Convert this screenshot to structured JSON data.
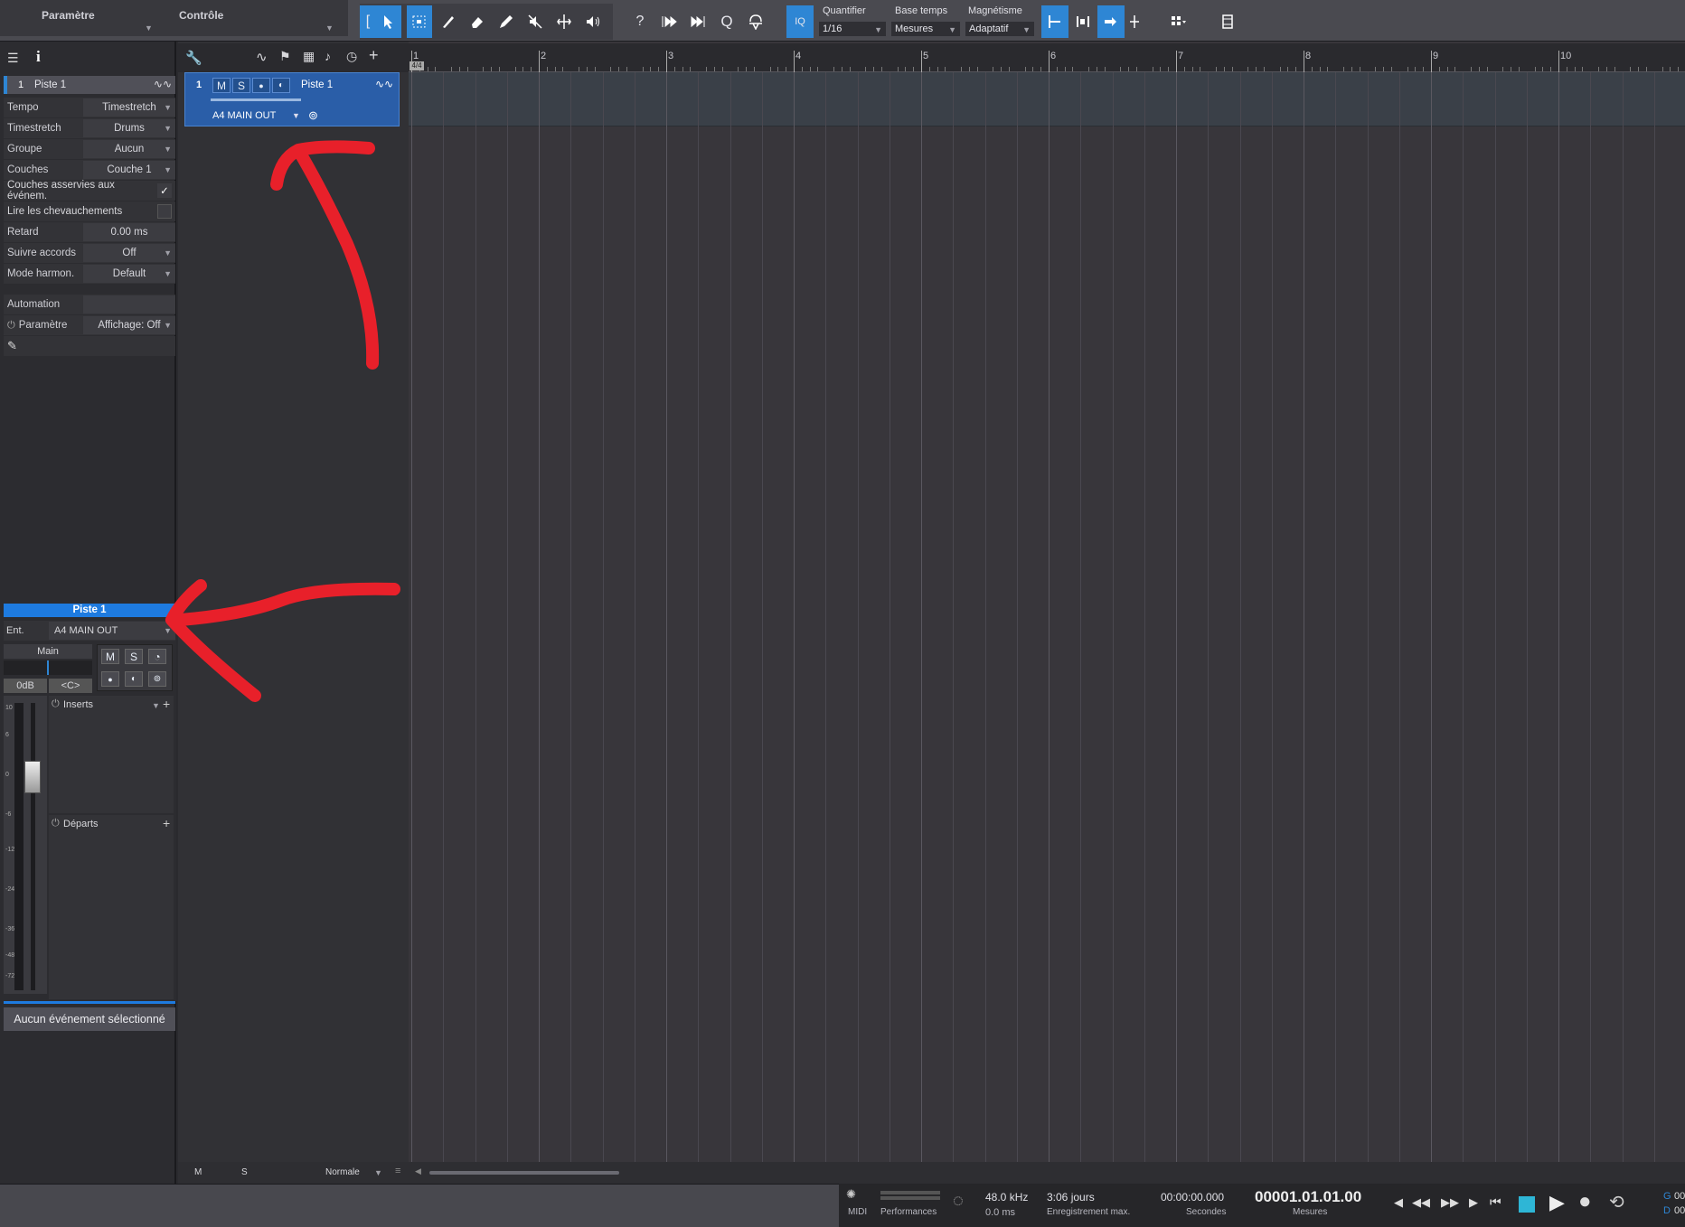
{
  "header": {
    "param_label": "Paramètre",
    "control_label": "Contrôle"
  },
  "toolbar": {
    "iq_label": "IQ",
    "quantize_label": "Quantifier",
    "quantize_value": "1/16",
    "timebase_label": "Base temps",
    "timebase_value": "Mesures",
    "snap_label": "Magnétisme",
    "snap_value": "Adaptatif",
    "help_label": "?",
    "q_label": "Q"
  },
  "inspector": {
    "track_number": "1",
    "track_name": "Piste 1",
    "rows": [
      {
        "key": "Tempo",
        "value": "Timestretch"
      },
      {
        "key": "Timestretch",
        "value": "Drums"
      },
      {
        "key": "Groupe",
        "value": "Aucun"
      },
      {
        "key": "Couches",
        "value": "Couche 1"
      }
    ],
    "layers_follow_label": "Couches asservies aux événem.",
    "play_overlaps_label": "Lire les chevauchements",
    "delay_label": "Retard",
    "delay_value": "0.00 ms",
    "follow_chords_label": "Suivre accords",
    "follow_chords_value": "Off",
    "harmonic_mode_label": "Mode harmon.",
    "harmonic_mode_value": "Default",
    "automation_label": "Automation",
    "param_label": "Paramètre",
    "display_value": "Affichage: Off"
  },
  "channel": {
    "name": "Piste 1",
    "input_label": "Ent.",
    "input_value": "A4 MAIN OUT",
    "main_label": "Main",
    "m": "M",
    "s": "S",
    "volume_label": "0dB",
    "pan_label": "<C>",
    "inserts_label": "Inserts",
    "sends_label": "Départs",
    "scale": [
      "10",
      "6",
      "0",
      "-6",
      "-12",
      "-24",
      "-36",
      "-48",
      "-72"
    ],
    "no_event": "Aucun événement sélectionné"
  },
  "track": {
    "number": "1",
    "m": "M",
    "s": "S",
    "name": "Piste 1",
    "output": "A4 MAIN OUT"
  },
  "ruler": {
    "bars": [
      "1",
      "2",
      "3",
      "4",
      "5",
      "6",
      "7",
      "8",
      "9",
      "10"
    ],
    "signature": "4/4"
  },
  "footer": {
    "m": "M",
    "s": "S",
    "mode": "Normale"
  },
  "transport": {
    "midi_label": "MIDI",
    "performance_label": "Performances",
    "sample_rate": "48.0 kHz",
    "latency": "0.0 ms",
    "record_time": "3:06 jours",
    "record_label": "Enregistrement max.",
    "seconds_value": "00:00:00.000",
    "seconds_label": "Secondes",
    "bars_value": "00001.01.01.00",
    "bars_label": "Mesures",
    "g_label": "G",
    "d_label": "D",
    "g_value": "00",
    "d_value": "00"
  },
  "colors": {
    "accent": "#2e86d4",
    "annotation": "#e8202a"
  }
}
